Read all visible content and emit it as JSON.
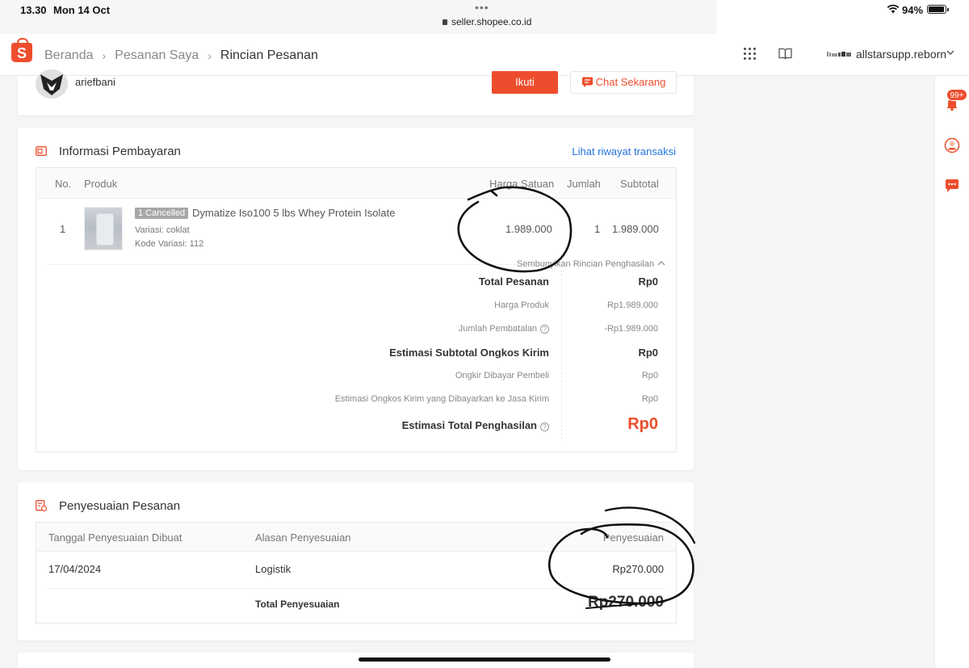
{
  "status_bar": {
    "time": "13.30",
    "date": "Mon 14 Oct",
    "url": "seller.shopee.co.id",
    "battery": "94%"
  },
  "nav": {
    "logo_letter": "S",
    "breadcrumbs": [
      "Beranda",
      "Pesanan Saya",
      "Rincian Pesanan"
    ],
    "shop_name": "allstarsupp.reborn"
  },
  "sidebar": {
    "notification_badge": "99+"
  },
  "buyer": {
    "name": "ariefbani",
    "follow_label": "Ikuti",
    "chat_label": "Chat Sekarang"
  },
  "payment": {
    "title": "Informasi Pembayaran",
    "history_link": "Lihat riwayat transaksi",
    "columns": {
      "no": "No.",
      "product": "Produk",
      "unit_price": "Harga Satuan",
      "qty": "Jumlah",
      "subtotal": "Subtotal"
    },
    "item": {
      "no": "1",
      "tag": "1 Cancelled",
      "name": "Dymatize Iso100 5 lbs Whey Protein Isolate",
      "variation": "Variasi: coklat",
      "variation_code": "Kode Variasi: 112",
      "unit_price": "1.989.000",
      "qty": "1",
      "subtotal": "1.989.000"
    },
    "toggle_label": "Sembunyikan Rincian Penghasilan",
    "summary": {
      "total_order_label": "Total Pesanan",
      "total_order_value": "Rp0",
      "product_price_label": "Harga Produk",
      "product_price_value": "Rp1.989.000",
      "cancel_amount_label": "Jumlah Pembatalan",
      "cancel_amount_value": "-Rp1.989.000",
      "shipping_subtotal_label": "Estimasi Subtotal Ongkos Kirim",
      "shipping_subtotal_value": "Rp0",
      "buyer_paid_shipping_label": "Ongkir Dibayar Pembeli",
      "buyer_paid_shipping_value": "Rp0",
      "courier_paid_label": "Estimasi Ongkos Kirim yang Dibayarkan ke Jasa Kirim",
      "courier_paid_value": "Rp0",
      "total_income_label": "Estimasi Total Penghasilan",
      "total_income_value": "Rp0"
    }
  },
  "adjustment": {
    "title": "Penyesuaian Pesanan",
    "columns": {
      "date": "Tanggal Penyesuaian Dibuat",
      "reason": "Alasan Penyesuaian",
      "amount": "Penyesuaian"
    },
    "row": {
      "date": "17/04/2024",
      "reason": "Logistik",
      "amount": "Rp270.000"
    },
    "total_label": "Total Penyesuaian",
    "total_value": "Rp270.000"
  },
  "colors": {
    "brand": "#ee4d2d",
    "link": "#2673dd"
  }
}
